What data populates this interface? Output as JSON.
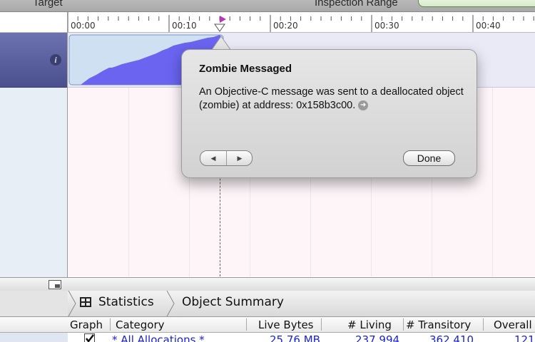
{
  "toolbar": {
    "target_label": "Target",
    "inspection_range_label": "Inspection Range"
  },
  "ruler": {
    "ticks": [
      "00:00",
      "00:10",
      "00:20",
      "00:30",
      "00:40"
    ]
  },
  "popover": {
    "title": "Zombie Messaged",
    "body": "An Objective-C message was sent to a deallocated object (zombie) at address: 0x158b3c00.",
    "prev_icon": "left-triangle-icon",
    "next_icon": "right-triangle-icon",
    "done_label": "Done"
  },
  "breadcrumb": {
    "statistics_label": "Statistics",
    "object_summary_label": "Object Summary"
  },
  "table": {
    "columns": [
      "Graph",
      "Category",
      "Live Bytes",
      "# Living",
      "# Transitory",
      "Overall"
    ],
    "rows": [
      {
        "category": "* All Allocations *",
        "live_bytes": "25.76 MB",
        "living": "237,994",
        "transitory": "362,410",
        "overall": "121",
        "graph_checked": true
      }
    ]
  },
  "colors": {
    "track_header": "#5a60a0",
    "graph_fill": "#6a64f0",
    "link_text": "#1b22d8"
  }
}
